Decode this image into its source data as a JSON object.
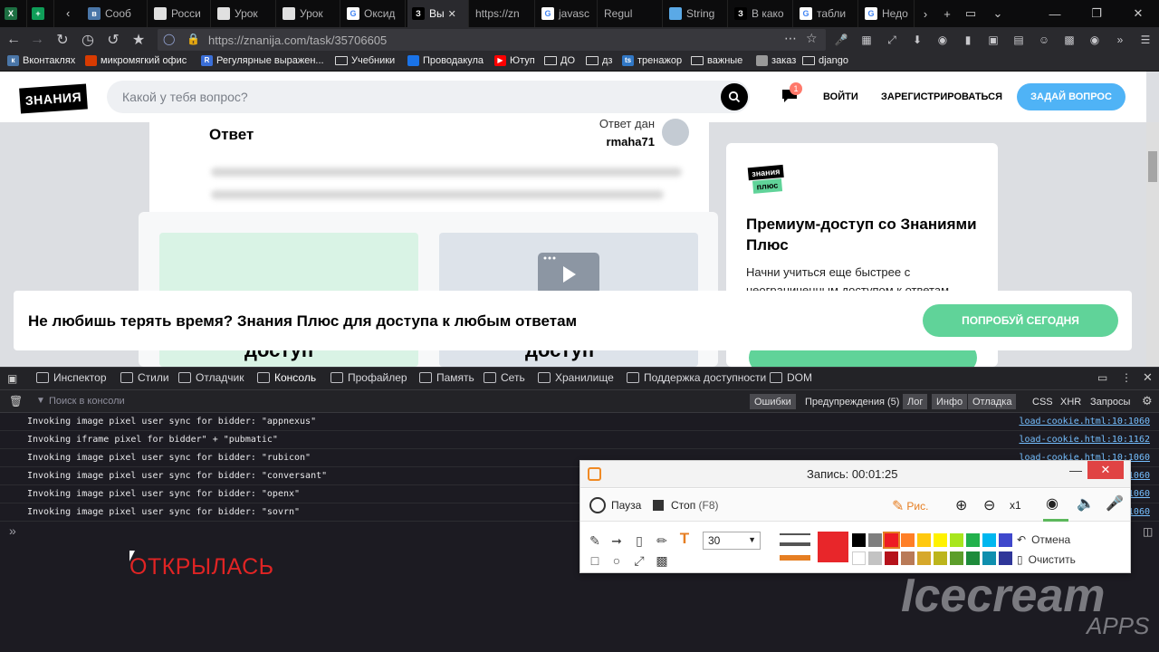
{
  "tabs": [
    {
      "label": "",
      "fav": "#1d6f42",
      "glyph": "X"
    },
    {
      "label": "",
      "fav": "#0f9d58",
      "glyph": "+"
    },
    {
      "label": "Сооб",
      "fav": "#4a76a8",
      "glyph": "в"
    },
    {
      "label": "Росси",
      "fav": "#e0e0e0",
      "glyph": ""
    },
    {
      "label": "Урок",
      "fav": "#e0e0e0",
      "glyph": ""
    },
    {
      "label": "Урок",
      "fav": "#e0e0e0",
      "glyph": ""
    },
    {
      "label": "Оксид",
      "fav": "#ffffff",
      "glyph": "G"
    },
    {
      "label": "Вы",
      "fav": "#000000",
      "glyph": "З",
      "active": true
    },
    {
      "label": "https://zn",
      "fav": "",
      "glyph": ""
    },
    {
      "label": "javasc",
      "fav": "#ffffff",
      "glyph": "G"
    },
    {
      "label": "Regul",
      "fav": "",
      "glyph": ""
    },
    {
      "label": "String",
      "fav": "#5aa9e6",
      "glyph": ""
    },
    {
      "label": "В како",
      "fav": "#000000",
      "glyph": "З"
    },
    {
      "label": "табли",
      "fav": "#ffffff",
      "glyph": "G"
    },
    {
      "label": "Недо",
      "fav": "#ffffff",
      "glyph": "G"
    }
  ],
  "nav": {
    "url": "https://znanija.com/task/35706605"
  },
  "bookmarks": [
    {
      "label": "Вконтаклях",
      "icon": "vk",
      "color": "#4a76a8"
    },
    {
      "label": "микромягкий офис",
      "icon": "office",
      "color": "#d83b01"
    },
    {
      "label": "Регулярные выражен...",
      "icon": "regex",
      "color": "#3b6fd8"
    },
    {
      "label": "Учебники",
      "icon": "folder"
    },
    {
      "label": "Проводакула",
      "icon": "drive",
      "color": "#1a73e8"
    },
    {
      "label": "Ютуп",
      "icon": "youtube",
      "color": "#ff0000"
    },
    {
      "label": "ДО",
      "icon": "folder"
    },
    {
      "label": "дз",
      "icon": "folder"
    },
    {
      "label": "тренажор",
      "icon": "ts",
      "color": "#3178c6"
    },
    {
      "label": "важные",
      "icon": "folder"
    },
    {
      "label": "заказ",
      "icon": "globe",
      "color": "#999"
    },
    {
      "label": "django",
      "icon": "folder"
    }
  ],
  "site": {
    "logo": "ЗНАНИЯ",
    "search_placeholder": "Какой у тебя вопрос?",
    "notif_count": "1",
    "login": "ВОЙТИ",
    "register": "ЗАРЕГИСТРИРОВАТЬСЯ",
    "ask": "ЗАДАЙ ВОПРОС",
    "answer_title": "Ответ",
    "answered_by": "Ответ дан",
    "answer_user": "rmaha71",
    "dostup": "доступ",
    "plus_logo_1": "знания",
    "plus_logo_2": "плюс",
    "premium_title": "Премиум-доступ со Знаниями Плюс",
    "premium_desc": "Начни учиться еще быстрее с неограниченным доступом к ответам",
    "banner_text": "Не любишь терять время? Знания Плюс для доступа к любым ответам",
    "banner_button": "ПОПРОБУЙ СЕГОДНЯ"
  },
  "devtools": {
    "tabs": [
      "Инспектор",
      "Стили",
      "Отладчик",
      "Консоль",
      "Профайлер",
      "Память",
      "Сеть",
      "Хранилище",
      "Поддержка доступности",
      "DOM"
    ],
    "active_tab": "Консоль",
    "filter_placeholder": "Поиск в консоли",
    "filters": [
      "Ошибки",
      "Предупреждения (5)",
      "Лог",
      "Инфо",
      "Отладка",
      "CSS",
      "XHR",
      "Запросы"
    ],
    "logs": [
      {
        "msg": "Invoking image pixel user sync for bidder: \"appnexus\"",
        "src": "load-cookie.html:10:1060"
      },
      {
        "msg": "Invoking iframe pixel for bidder\" + \"pubmatic\"",
        "src": "load-cookie.html:10:1162"
      },
      {
        "msg": "Invoking image pixel user sync for bidder: \"rubicon\"",
        "src": "load-cookie.html:10:1060"
      },
      {
        "msg": "Invoking image pixel user sync for bidder: \"conversant\"",
        "src": "load-cookie.html:10:1060"
      },
      {
        "msg": "Invoking image pixel user sync for bidder: \"openx\"",
        "src": "load-cookie.html:10:1060"
      },
      {
        "msg": "Invoking image pixel user sync for bidder: \"sovrn\"",
        "src": "load-cookie.html:10:1060"
      }
    ],
    "annotation": "ОТКРЫЛАСЬ"
  },
  "recorder": {
    "title": "Запись:  00:01:25",
    "pause": "Пауза",
    "stop": "Стоп",
    "stop_hotkey": "(F8)",
    "draw": "Рис.",
    "zoom": "x1",
    "size": "30",
    "undo": "Отмена",
    "clear": "Очистить",
    "current_color": "#e8262a",
    "palette": [
      "#000000",
      "#7f7f7f",
      "#ed1c24",
      "#ff7f27",
      "#ffc90e",
      "#fff200",
      "#a8e61d",
      "#22b14c",
      "#00b7ef",
      "#3f48cc",
      "#ffffff",
      "#c3c3c3",
      "#b5121b",
      "#b97a57",
      "#d6a82b",
      "#bcb51c",
      "#5c9e2b",
      "#1e8b3b",
      "#0f8fae",
      "#2f3699"
    ]
  },
  "watermark": {
    "main": "Icecream",
    "sub": "APPS"
  }
}
